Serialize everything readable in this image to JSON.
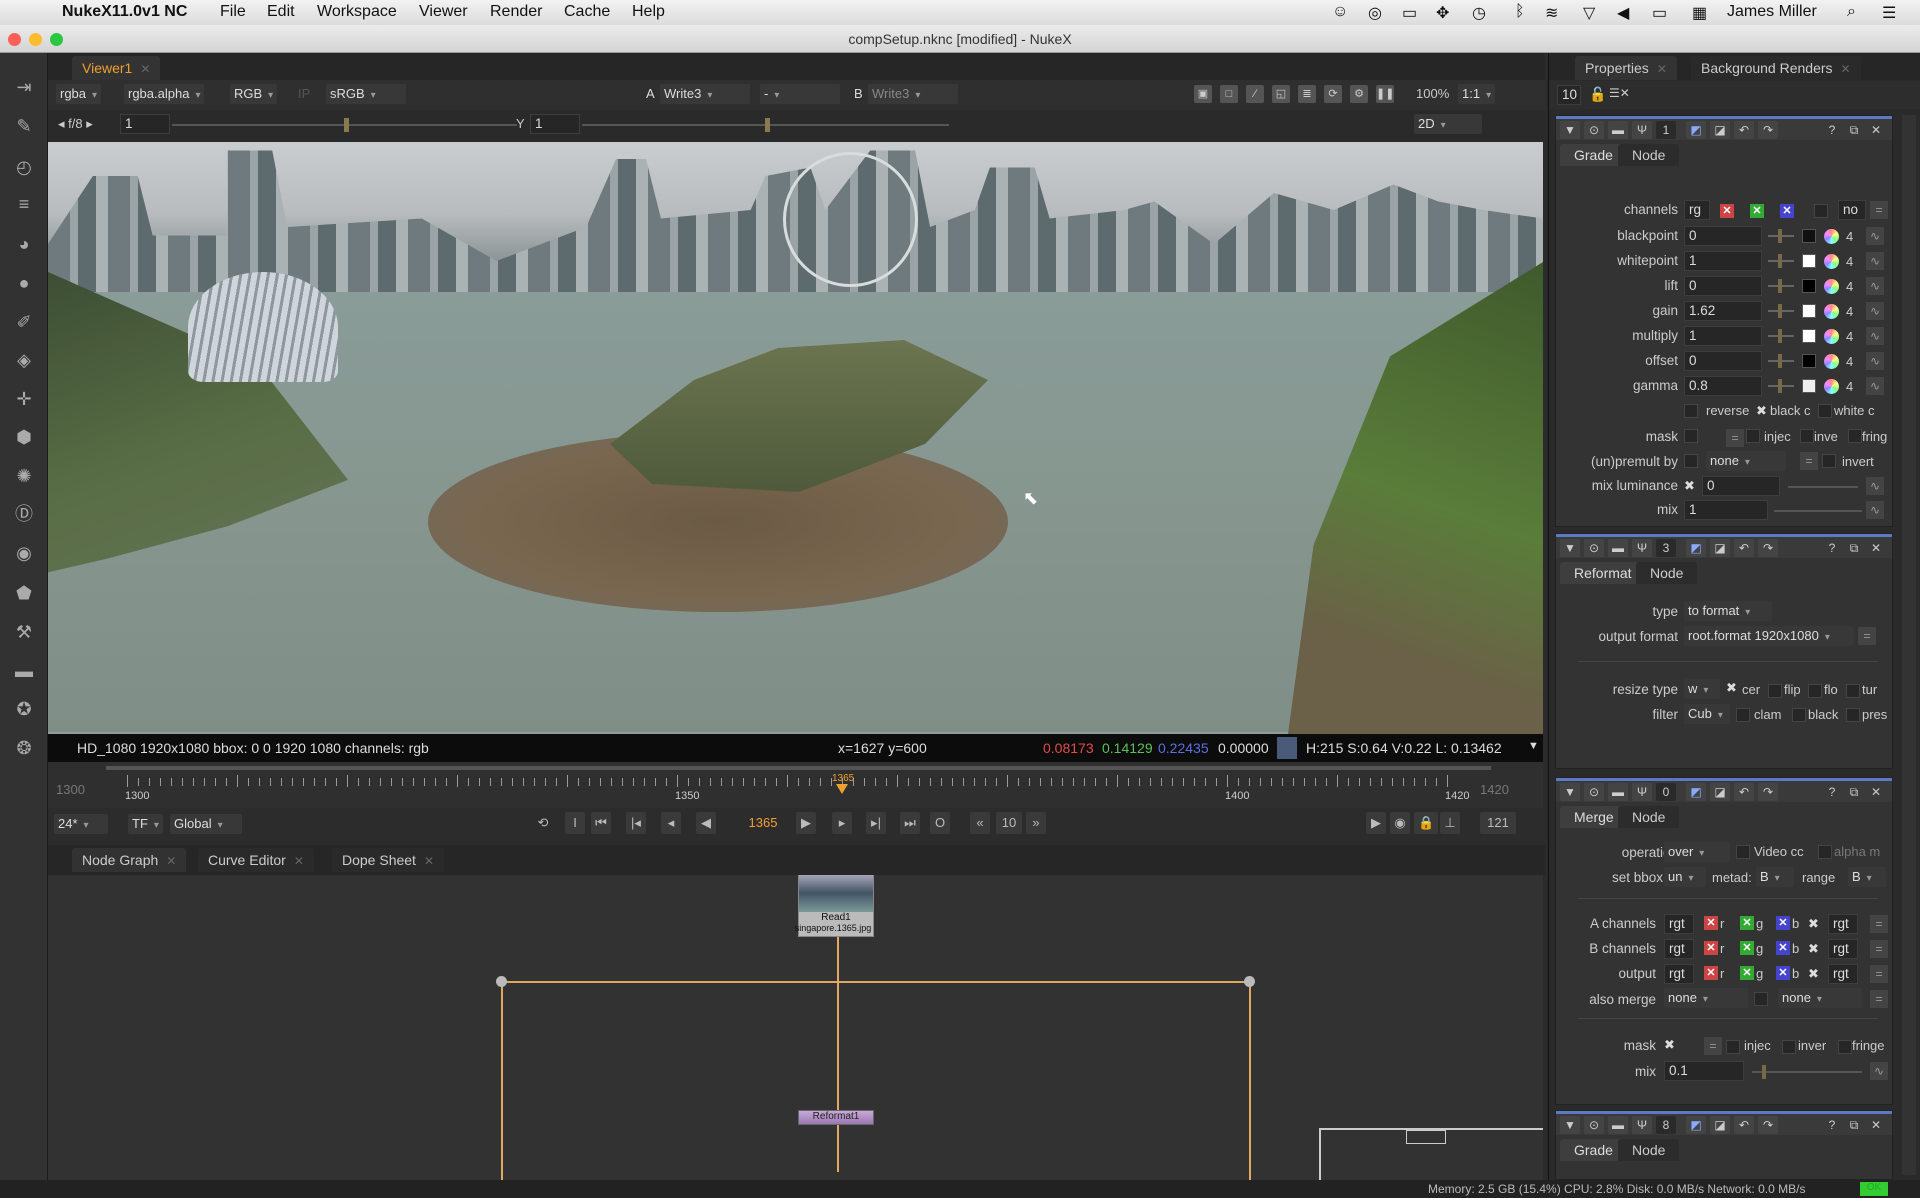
{
  "menubar": {
    "app": "NukeX11.0v1 NC",
    "items": [
      "File",
      "Edit",
      "Workspace",
      "Viewer",
      "Render",
      "Cache",
      "Help"
    ],
    "user": "James Miller"
  },
  "window": {
    "title": "compSetup.nknc [modified] - NukeX"
  },
  "viewer": {
    "tab": "Viewer1",
    "channels": "rgba",
    "alpha": "rgba.alpha",
    "display": "RGB",
    "ip": "IP",
    "lut": "sRGB",
    "a_label": "A",
    "a_input": "Write3",
    "blend": "-",
    "b_label": "B",
    "b_input": "Write3",
    "zoom": "100%",
    "ratio": "1:1",
    "fstop": "f/8",
    "gain": "1",
    "y_label": "Y",
    "gamma": "1",
    "mode": "2D",
    "info": {
      "format": "HD_1080 1920x1080  bbox: 0 0 1920 1080 channels: rgb",
      "coords": "x=1627 y=600",
      "r": "0.08173",
      "g": "0.14129",
      "b": "0.22435",
      "a": "0.00000",
      "hsv": "H:215 S:0.64 V:0.22  L: 0.13462",
      "swatch": "#4a5a78"
    }
  },
  "timeline": {
    "start": "1300",
    "end": "1420",
    "ticks": [
      "1300",
      "1350",
      "1400",
      "1420"
    ],
    "current": "1365",
    "fps": "24*",
    "tf": "TF",
    "scope": "Global",
    "step": "10",
    "frames": "121",
    "range": [
      1300,
      1420
    ],
    "current_value": 1365
  },
  "bottom_tabs": [
    "Node Graph",
    "Curve Editor",
    "Dope Sheet"
  ],
  "nodes": {
    "read": "Read1",
    "read_file": "singapore.1365.jpg",
    "reformat": "Reformat1"
  },
  "properties": {
    "tabs": [
      "Properties",
      "Background Renders"
    ],
    "max_panels": "10",
    "grade1": {
      "num": "1",
      "tabs": [
        "Grade",
        "Node"
      ],
      "channels_label": "channels",
      "channels": "rg",
      "rows": [
        {
          "label": "blackpoint",
          "value": "0",
          "swatch": "#111111"
        },
        {
          "label": "whitepoint",
          "value": "1",
          "swatch": "#ffffff"
        },
        {
          "label": "lift",
          "value": "0",
          "swatch": "#000000"
        },
        {
          "label": "gain",
          "value": "1.62",
          "swatch": "#ffffff"
        },
        {
          "label": "multiply",
          "value": "1",
          "swatch": "#ffffff"
        },
        {
          "label": "offset",
          "value": "0",
          "swatch": "#000000"
        },
        {
          "label": "gamma",
          "value": "0.8",
          "swatch": "#eeeeee"
        }
      ],
      "reverse": "reverse",
      "black_clamp": "black c",
      "white_clamp": "white c",
      "mask": "mask",
      "inject": "injec",
      "invert_short": "inve",
      "fringe": "fring",
      "unpremult": "(un)premult by",
      "unpremult_value": "none",
      "invert": "invert",
      "mixlum": "mix luminance",
      "mixlum_value": "0",
      "mix": "mix",
      "mix_value": "1",
      "dim_count": "4",
      "none_btn": "no"
    },
    "reformat": {
      "num": "3",
      "tabs": [
        "Reformat",
        "Node"
      ],
      "type_label": "type",
      "type": "to format",
      "format_label": "output format",
      "format": "root.format 1920x1080",
      "resize_label": "resize type",
      "resize": "w",
      "center": "cer",
      "flip": "flip",
      "flop": "flo",
      "turn": "tur",
      "filter_label": "filter",
      "filter": "Cub",
      "clamp": "clam",
      "black": "black",
      "preserve": "pres"
    },
    "merge": {
      "num": "0",
      "tabs": [
        "Merge",
        "Node"
      ],
      "op_label": "operation",
      "op": "over",
      "video": "Video cc",
      "alpha": "alpha m",
      "bbox_label": "set bbox to",
      "bbox": "un",
      "metadata": "metad:",
      "metadata_value": "B",
      "range": "range",
      "range_value": "B",
      "chan_rows": [
        {
          "label": "A channels"
        },
        {
          "label": "B channels"
        },
        {
          "label": "output"
        }
      ],
      "chan": "rgt",
      "r": "r",
      "g": "g",
      "b": "b",
      "also_label": "also merge",
      "also1": "none",
      "also2": "none",
      "mask": "mask",
      "inject": "injec",
      "invert": "inver",
      "fringe": "fringe",
      "mix": "mix",
      "mix_value": "0.1"
    },
    "grade2": {
      "num": "8",
      "tabs": [
        "Grade",
        "Node"
      ]
    }
  },
  "status": {
    "text": "Memory: 2.5 GB (15.4%) CPU: 2.8% Disk: 0.0 MB/s Network: 0.0 MB/s",
    "ok": "OK"
  }
}
